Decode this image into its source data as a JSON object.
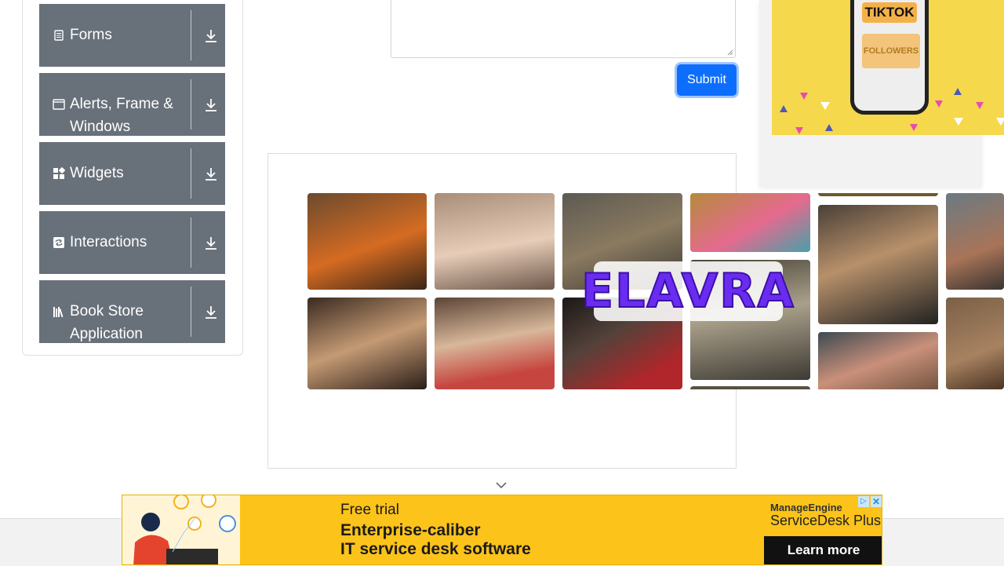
{
  "sidebar": {
    "groups": [
      {
        "label": "Forms",
        "icon": "form-icon"
      },
      {
        "label": "Alerts, Frame & Windows",
        "icon": "window-icon"
      },
      {
        "label": "Widgets",
        "icon": "widgets-icon"
      },
      {
        "label": "Interactions",
        "icon": "interactions-icon"
      },
      {
        "label": "Book Store Application",
        "icon": "book-icon"
      }
    ]
  },
  "form": {
    "textarea_value": "",
    "submit_label": "Submit"
  },
  "ads": {
    "collage_brand": "ELAVRA",
    "tiktok_label": "TIKTOK",
    "followers_label": "FOLLOWERS",
    "banner": {
      "free_trial": "Free trial",
      "line1": "Enterprise-caliber",
      "line2": "IT service desk software",
      "brand_top": "ManageEngine",
      "brand_name": "ServiceDesk Plus",
      "cta": "Learn more",
      "adchoices_glyph": "▷",
      "close_glyph": "✕"
    }
  },
  "colors": {
    "group_bg": "#68707a",
    "submit_bg": "#0d6efd",
    "banner_bg": "#fcc31a",
    "tiktok_bg": "#f6d84c"
  }
}
